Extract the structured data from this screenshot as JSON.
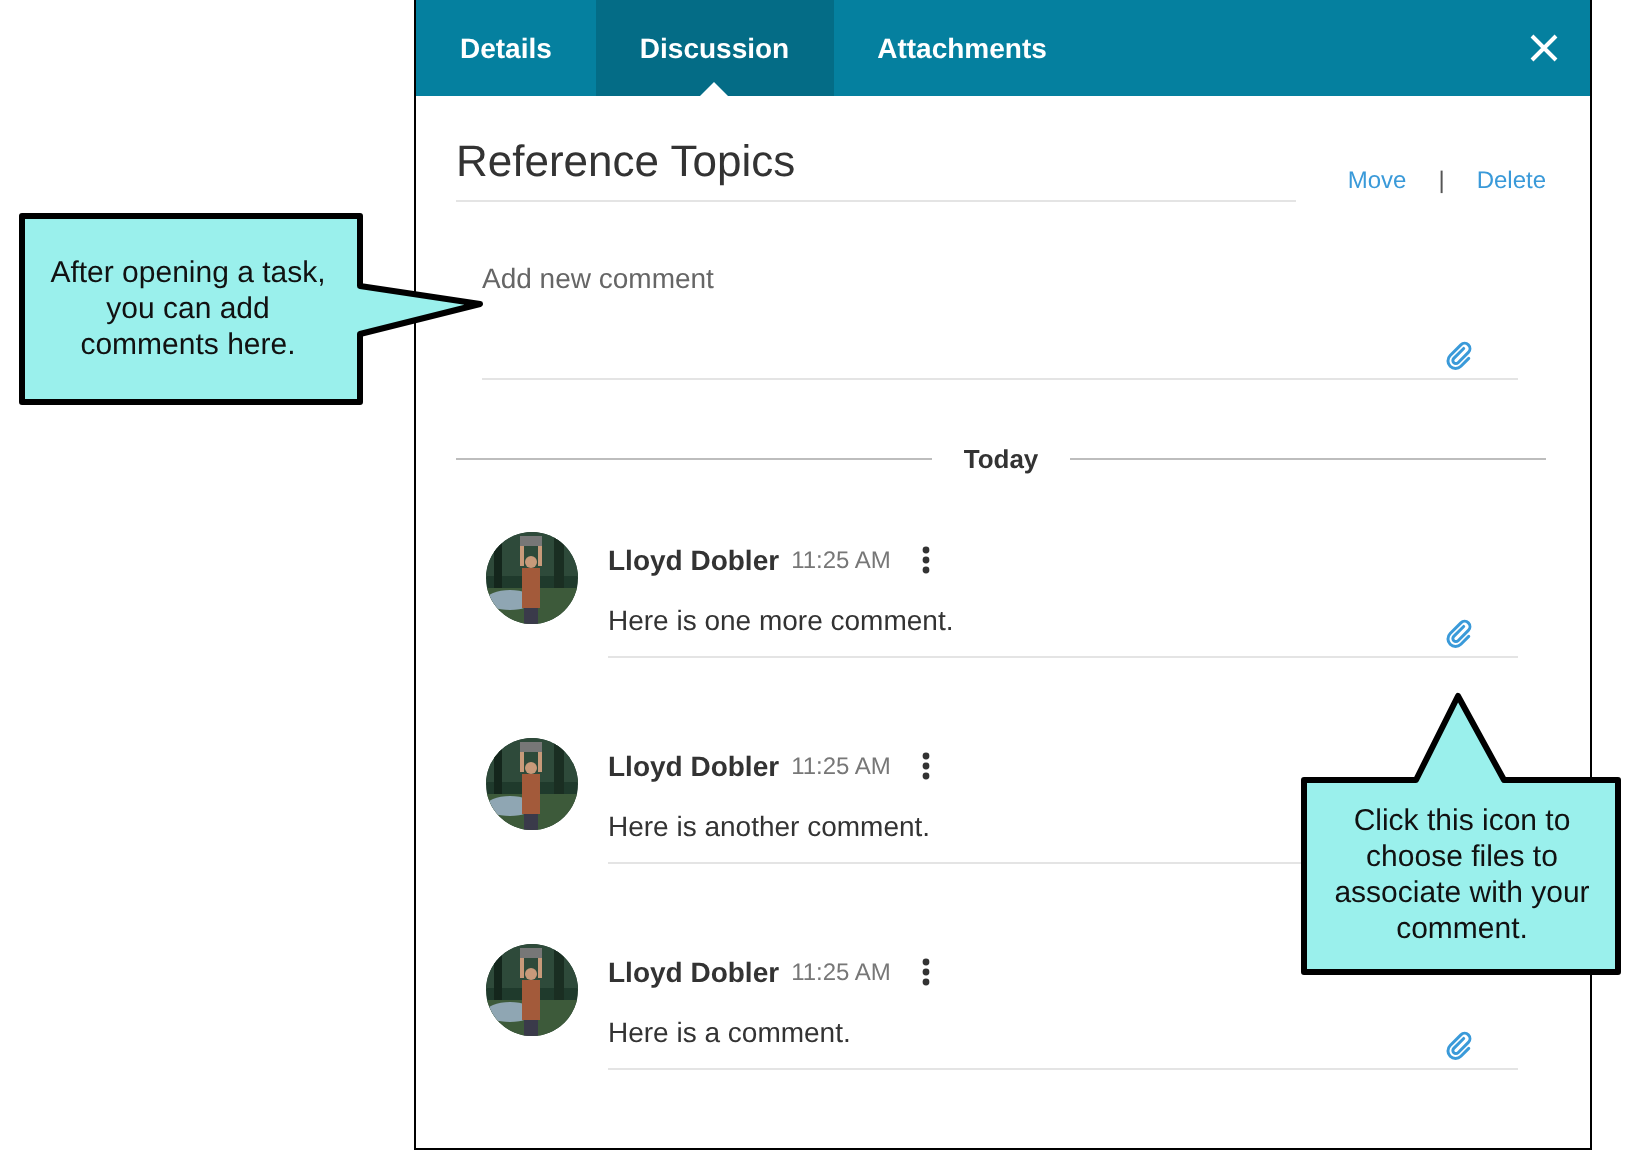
{
  "tabs": [
    {
      "label": "Details",
      "selected": false
    },
    {
      "label": "Discussion",
      "selected": true
    },
    {
      "label": "Attachments",
      "selected": false
    }
  ],
  "task": {
    "title": "Reference Topics",
    "actions": [
      "Move",
      "Delete"
    ],
    "separator": "|"
  },
  "new_comment": {
    "placeholder": "Add new comment"
  },
  "date_divider": "Today",
  "comments": [
    {
      "author": "Lloyd Dobler",
      "time": "11:25 AM",
      "text": "Here is one more comment.",
      "attach_icon": true
    },
    {
      "author": "Lloyd Dobler",
      "time": "11:25 AM",
      "text": "Here is another comment.",
      "attach_icon": false
    },
    {
      "author": "Lloyd Dobler",
      "time": "11:25 AM",
      "text": "Here is a comment.",
      "attach_icon": true
    }
  ],
  "callouts": [
    {
      "text": "After opening a task, you can add comments here.",
      "kind": "right"
    },
    {
      "text": "Click this icon to choose files to associate with your comment.",
      "kind": "up"
    }
  ]
}
